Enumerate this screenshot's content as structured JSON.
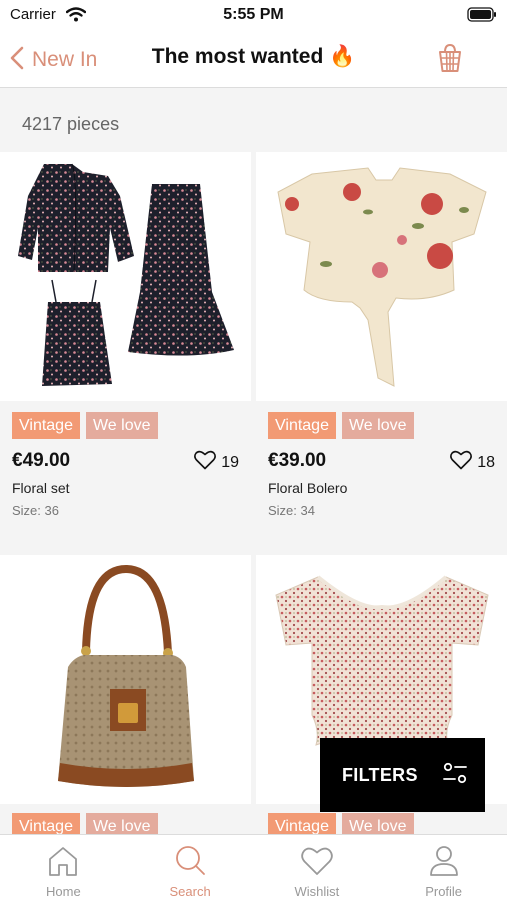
{
  "status_bar": {
    "carrier": "Carrier",
    "time": "5:55 PM"
  },
  "nav": {
    "back_label": "New In",
    "title": "The most wanted 🔥"
  },
  "listing": {
    "count_text": "4217 pieces"
  },
  "products": [
    {
      "badges": [
        "Vintage",
        "We love"
      ],
      "price": "€49.00",
      "likes": "19",
      "name": "Floral set",
      "size": "Size: 36"
    },
    {
      "badges": [
        "Vintage",
        "We love"
      ],
      "price": "€39.00",
      "likes": "18",
      "name": "Floral Bolero",
      "size": "Size: 34"
    },
    {
      "badges": [
        "Vintage",
        "We love"
      ]
    },
    {
      "badges": [
        "Vintage",
        "We love"
      ]
    }
  ],
  "filters": {
    "label": "FILTERS"
  },
  "tabs": [
    {
      "label": "Home",
      "icon": "home-icon",
      "active": false
    },
    {
      "label": "Search",
      "icon": "search-icon",
      "active": true
    },
    {
      "label": "Wishlist",
      "icon": "heart-icon",
      "active": false
    },
    {
      "label": "Profile",
      "icon": "person-icon",
      "active": false
    }
  ],
  "colors": {
    "accent": "#d98f79",
    "vintage_badge": "#f29a74",
    "love_badge": "#e4ab9d"
  }
}
